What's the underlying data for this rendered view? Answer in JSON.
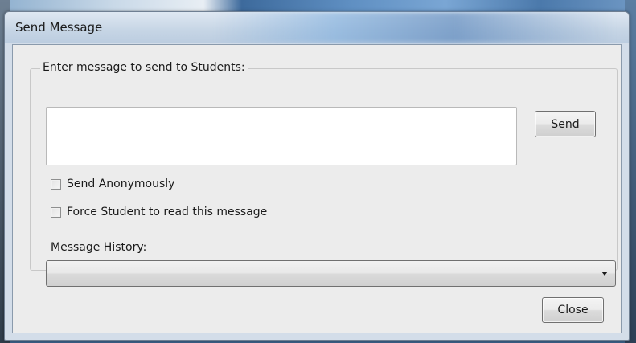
{
  "window": {
    "title": "Send Message"
  },
  "compose": {
    "group_label": "Enter message to send to Students:",
    "message_value": "",
    "send_label": "Send"
  },
  "options": {
    "anonymous_label": "Send Anonymously",
    "anonymous_checked": false,
    "force_read_label": "Force Student to read this message",
    "force_read_checked": false
  },
  "history": {
    "label": "Message History:",
    "selected_value": ""
  },
  "footer": {
    "close_label": "Close"
  },
  "icons": {
    "dropdown": "chevron-down-icon"
  },
  "colors": {
    "window_frame": "#d3dde9",
    "client_bg": "#ececec",
    "button_border": "#707070"
  }
}
